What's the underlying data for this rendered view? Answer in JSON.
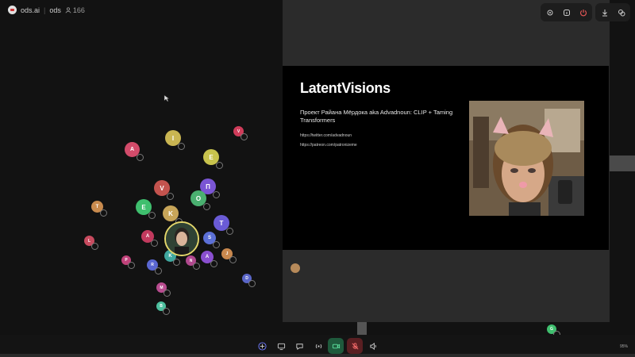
{
  "header": {
    "brand": "ods.ai",
    "space": "ods",
    "people_count": "166"
  },
  "slide": {
    "title": "LatentVisions",
    "subtitle": "Проект Райана Мёрдока aka Advadnoun: CLIP + Taming Transformers",
    "links": [
      "https://twitter.com/advadnoun",
      "https://patreon.com/patronizeme"
    ]
  },
  "toolbar_icons": [
    "settings-icon",
    "info-icon",
    "leave-icon",
    "download-icon",
    "people-icon"
  ],
  "bottom_controls": [
    "add-icon",
    "screen-share-icon",
    "chat-icon",
    "broadcast-icon",
    "camera-icon",
    "mic-muted-icon",
    "speaker-icon"
  ],
  "zoom": "95%",
  "colors": {
    "accent": "#e3d66a",
    "camera_on": "#2a8a5a",
    "mic_off": "#c0403e"
  },
  "avatars": [
    {
      "letter": "А",
      "color": "#d24b6a"
    },
    {
      "letter": "I",
      "color": "#c9b552"
    },
    {
      "letter": "V",
      "color": "#c3534e"
    },
    {
      "letter": "E",
      "color": "#c8c34d"
    },
    {
      "letter": "V",
      "color": "#cf3c5a"
    },
    {
      "letter": "П",
      "color": "#7a55d4"
    },
    {
      "letter": "E",
      "color": "#3fbf6e"
    },
    {
      "letter": "O",
      "color": "#4ab070"
    },
    {
      "letter": "K",
      "color": "#c7a559"
    },
    {
      "letter": "T",
      "color": "#6a5bd6"
    },
    {
      "letter": "S",
      "color": "#5b6fd6"
    },
    {
      "letter": "A",
      "color": "#c23a5e"
    },
    {
      "letter": "A",
      "color": "#8a4fd0"
    },
    {
      "letter": "L",
      "color": "#c84b5f"
    },
    {
      "letter": "T",
      "color": "#c98b4e"
    },
    {
      "letter": "N",
      "color": "#b0488e"
    },
    {
      "letter": "R",
      "color": "#5a67d1"
    },
    {
      "letter": "K",
      "color": "#3fa8a0"
    },
    {
      "letter": "M",
      "color": "#b84c8f"
    },
    {
      "letter": "B",
      "color": "#4dbf9e"
    },
    {
      "letter": "D",
      "color": "#5a66c8"
    },
    {
      "letter": "P",
      "color": "#c0427a"
    },
    {
      "letter": "J",
      "color": "#c9884e"
    },
    {
      "letter": "G",
      "color": "#3fbf6e"
    }
  ]
}
